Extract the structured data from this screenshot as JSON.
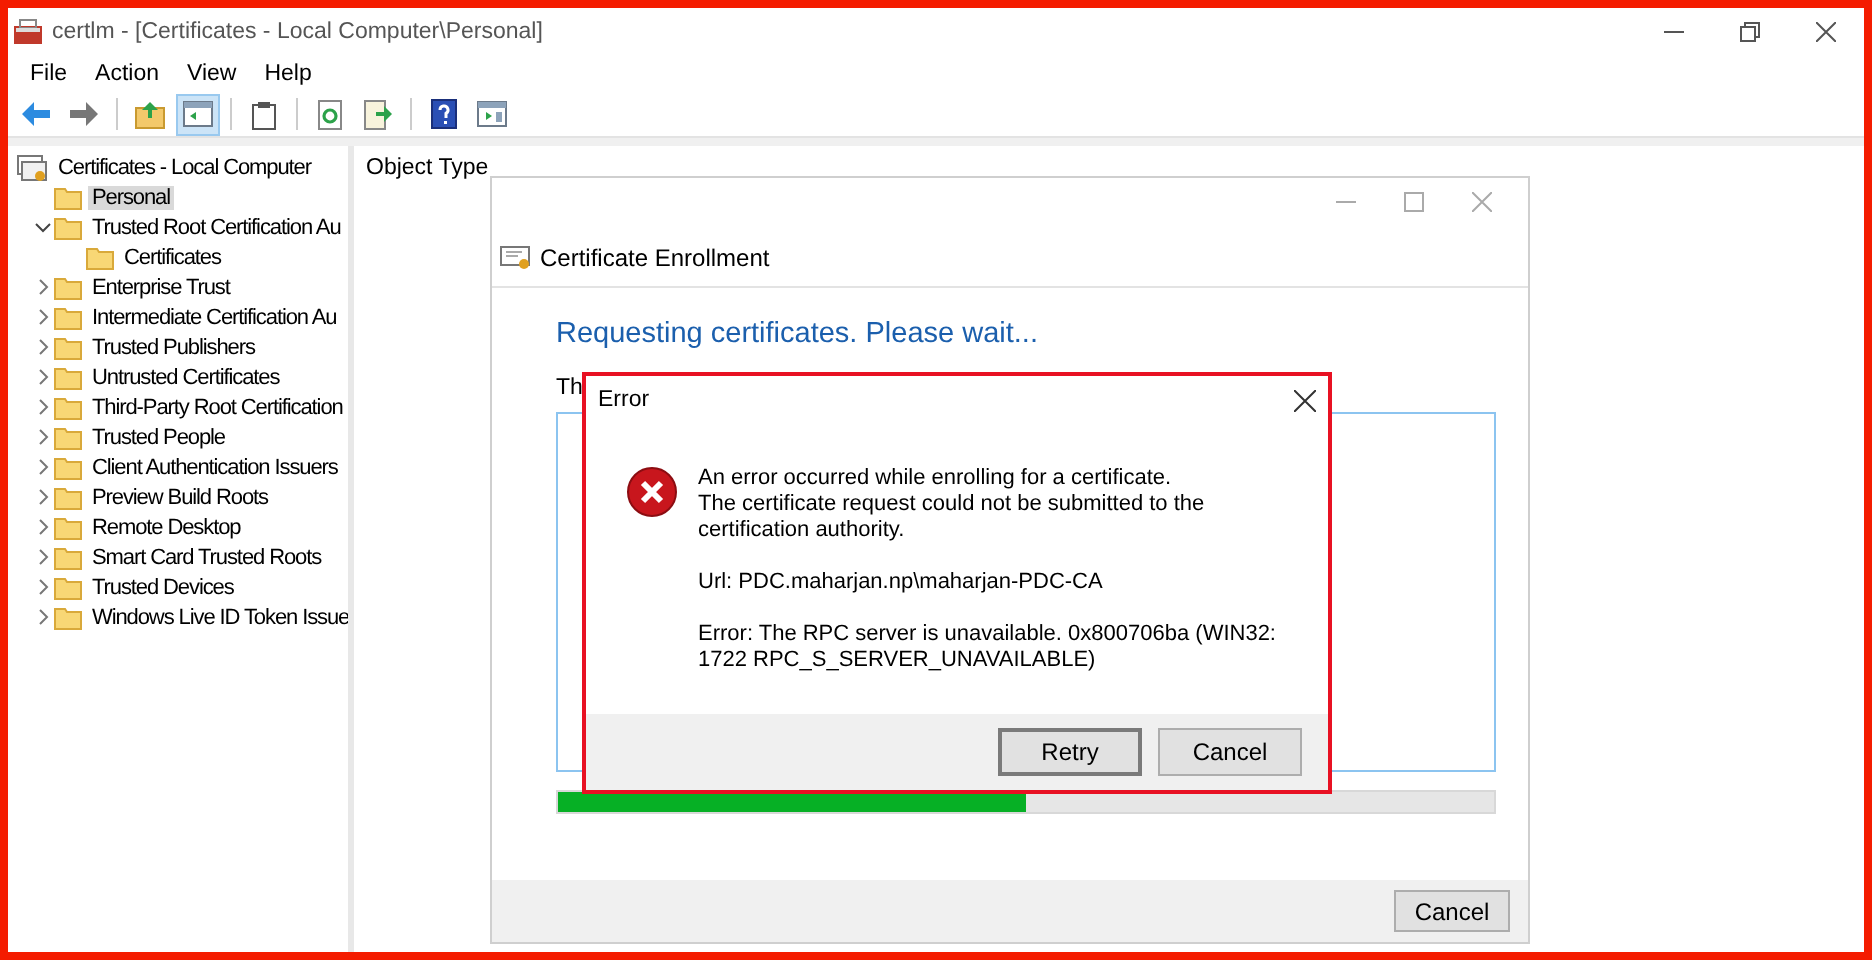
{
  "window": {
    "title": "certlm - [Certificates - Local Computer\\Personal]"
  },
  "menu": [
    {
      "label": "File"
    },
    {
      "label": "Action"
    },
    {
      "label": "View"
    },
    {
      "label": "Help"
    }
  ],
  "toolbar": [
    {
      "kind": "back",
      "selected": false
    },
    {
      "kind": "forward",
      "selected": false
    },
    {
      "kind": "sep"
    },
    {
      "kind": "up",
      "selected": false
    },
    {
      "kind": "tree",
      "selected": true
    },
    {
      "kind": "sep"
    },
    {
      "kind": "clipboard",
      "selected": false
    },
    {
      "kind": "sep"
    },
    {
      "kind": "refresh",
      "selected": false
    },
    {
      "kind": "export",
      "selected": false
    },
    {
      "kind": "sep"
    },
    {
      "kind": "help",
      "selected": false
    },
    {
      "kind": "console",
      "selected": false
    }
  ],
  "tree": {
    "label": "Certificates - Local Computer",
    "selected": false,
    "children": [
      {
        "label": "Personal",
        "selected": true,
        "expandable": false
      },
      {
        "label": "Trusted Root Certification Au",
        "selected": false,
        "expandable": true,
        "expanded": true,
        "children": [
          {
            "label": "Certificates",
            "selected": false,
            "expandable": false
          }
        ]
      },
      {
        "label": "Enterprise Trust",
        "selected": false,
        "expandable": true,
        "expanded": false
      },
      {
        "label": "Intermediate Certification Au",
        "selected": false,
        "expandable": true,
        "expanded": false
      },
      {
        "label": "Trusted Publishers",
        "selected": false,
        "expandable": true,
        "expanded": false
      },
      {
        "label": "Untrusted Certificates",
        "selected": false,
        "expandable": true,
        "expanded": false
      },
      {
        "label": "Third-Party Root Certification",
        "selected": false,
        "expandable": true,
        "expanded": false
      },
      {
        "label": "Trusted People",
        "selected": false,
        "expandable": true,
        "expanded": false
      },
      {
        "label": "Client Authentication Issuers",
        "selected": false,
        "expandable": true,
        "expanded": false
      },
      {
        "label": "Preview Build Roots",
        "selected": false,
        "expandable": true,
        "expanded": false
      },
      {
        "label": "Remote Desktop",
        "selected": false,
        "expandable": true,
        "expanded": false
      },
      {
        "label": "Smart Card Trusted Roots",
        "selected": false,
        "expandable": true,
        "expanded": false
      },
      {
        "label": "Trusted Devices",
        "selected": false,
        "expandable": true,
        "expanded": false
      },
      {
        "label": "Windows Live ID Token Issue",
        "selected": false,
        "expandable": true,
        "expanded": false
      }
    ]
  },
  "pane": {
    "columns": [
      "Object Type"
    ]
  },
  "enrollment": {
    "title": "Certificate Enrollment",
    "heading": "Requesting certificates. Please wait...",
    "status_text": "Th",
    "progress": {
      "level": 0.5
    },
    "buttons": [
      "Cancel"
    ]
  },
  "error_dialog": {
    "title": "Error",
    "paragraphs": [
      [
        "An error occurred while enrolling for a certificate.",
        "The certificate request could not be submitted to the certification authority."
      ],
      [
        "Url: PDC.maharjan.np\\maharjan-PDC-CA"
      ],
      [
        "Error: The RPC server is unavailable. 0x800706ba (WIN32: 1722 RPC_S_SERVER_UNAVAILABLE)"
      ]
    ],
    "buttons": [
      {
        "label": "Retry",
        "focused": true
      },
      {
        "label": "Cancel",
        "focused": false
      }
    ]
  }
}
